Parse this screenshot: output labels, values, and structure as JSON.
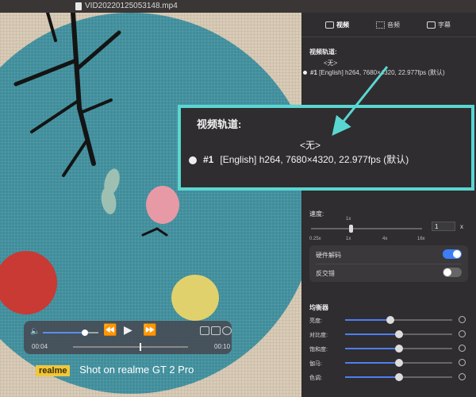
{
  "window": {
    "title": "VID20220125053148.mp4"
  },
  "video": {
    "watermark_brand": "realme",
    "watermark_text": "Shot on realme GT 2 Pro"
  },
  "player": {
    "elapsed": "00:04",
    "total": "00:10",
    "volume_fraction": 0.75,
    "progress_fraction": 0.58
  },
  "panel": {
    "tabs": [
      {
        "label": "视频",
        "icon": "video-icon",
        "active": true
      },
      {
        "label": "音频",
        "icon": "audio-wave-icon",
        "active": false
      },
      {
        "label": "字幕",
        "icon": "subtitle-icon",
        "active": false
      }
    ],
    "video_track_label": "视频轨道:",
    "track_none": "<无>",
    "tracks": [
      {
        "number": "#1",
        "description": "[English] h264, 7680×4320, 22.977fps (默认)"
      }
    ],
    "speed": {
      "label": "速度:",
      "value": "1",
      "unit": "x",
      "marker": "1x",
      "ticks": [
        "0.25x",
        "1x",
        "4x",
        "16x"
      ],
      "level_fraction": 0.36
    },
    "toggles": [
      {
        "label": "硬件解码",
        "on": true
      },
      {
        "label": "反交错",
        "on": false
      }
    ],
    "equalizer": {
      "label": "均衡器",
      "items": [
        {
          "label": "亮度:",
          "level": 0.42
        },
        {
          "label": "对比度:",
          "level": 0.5
        },
        {
          "label": "饱和度:",
          "level": 0.5
        },
        {
          "label": "伽马:",
          "level": 0.5
        },
        {
          "label": "色调:",
          "level": 0.5
        }
      ]
    }
  },
  "callout": {
    "label": "视频轨道:",
    "none": "<无>",
    "track_number": "#1",
    "track_description": "[English] h264, 7680×4320, 22.977fps (默认)"
  },
  "colors": {
    "accent": "#3d7ef6",
    "callout_border": "#5ad6d2",
    "mat": "#3f8d9b"
  }
}
